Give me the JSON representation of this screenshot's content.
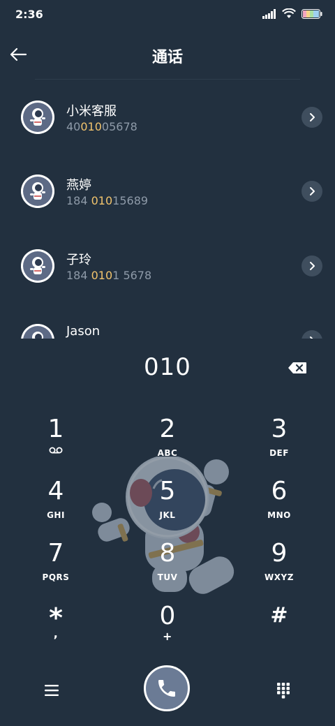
{
  "status_bar": {
    "time": "2:36",
    "icons": [
      "signal-icon",
      "wifi-icon",
      "battery-icon"
    ]
  },
  "header": {
    "title": "通话",
    "back_icon": "arrow-left-icon"
  },
  "contacts": [
    {
      "name": "小米客服",
      "number_parts": [
        "40",
        "010",
        "05678"
      ]
    },
    {
      "name": "燕婷",
      "number_parts": [
        "184 ",
        "010",
        "15689"
      ]
    },
    {
      "name": "子玲",
      "number_parts": [
        "184 ",
        "010",
        "1 5678"
      ]
    },
    {
      "name": "Jason",
      "number_parts": [
        "",
        "",
        ""
      ]
    }
  ],
  "dialer": {
    "input": "010",
    "keys": [
      {
        "digit": "1",
        "sub": ""
      },
      {
        "digit": "2",
        "sub": "ABC"
      },
      {
        "digit": "3",
        "sub": "DEF"
      },
      {
        "digit": "4",
        "sub": "GHI"
      },
      {
        "digit": "5",
        "sub": "JKL"
      },
      {
        "digit": "6",
        "sub": "MNO"
      },
      {
        "digit": "7",
        "sub": "PQRS"
      },
      {
        "digit": "8",
        "sub": "TUV"
      },
      {
        "digit": "9",
        "sub": "WXYZ"
      },
      {
        "digit": "*",
        "sub": ","
      },
      {
        "digit": "0",
        "sub": "+"
      },
      {
        "digit": "#",
        "sub": ""
      }
    ]
  },
  "colors": {
    "background": "#22303f",
    "highlight": "#f2c46d",
    "secondary_text": "#8e9aa8",
    "call_button": "#6b7b95"
  },
  "bottom_icons": [
    "menu-icon",
    "phone-icon",
    "dialpad-icon"
  ]
}
